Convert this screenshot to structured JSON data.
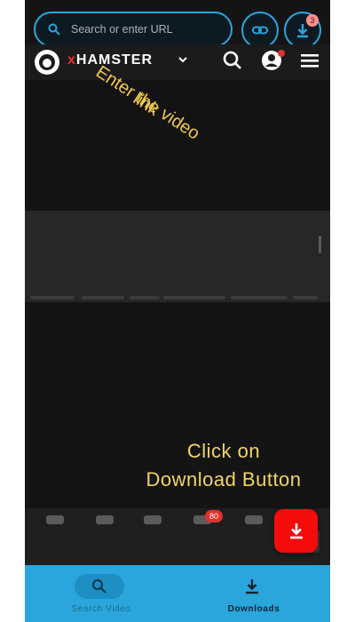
{
  "browser": {
    "search_placeholder": "Search or enter URL",
    "download_badge": "3",
    "accent_color": "#2aa6dd"
  },
  "site": {
    "logo_prefix": "x",
    "logo_text": "HAMSTER",
    "notification_badge": "80"
  },
  "overlays": {
    "enter_line1": "Enter the video",
    "enter_line2": "link",
    "click_line1": "Click on",
    "click_line2": "Download Button",
    "text_color": "#f2c94c"
  },
  "fab": {
    "icon": "download-icon",
    "color": "#f40b0b"
  },
  "bottom_nav": {
    "items": [
      {
        "label": "Search Video",
        "icon": "search-icon",
        "active": false
      },
      {
        "label": "Downloads",
        "icon": "download-icon",
        "active": true
      }
    ],
    "background": "#2aa6dd"
  }
}
